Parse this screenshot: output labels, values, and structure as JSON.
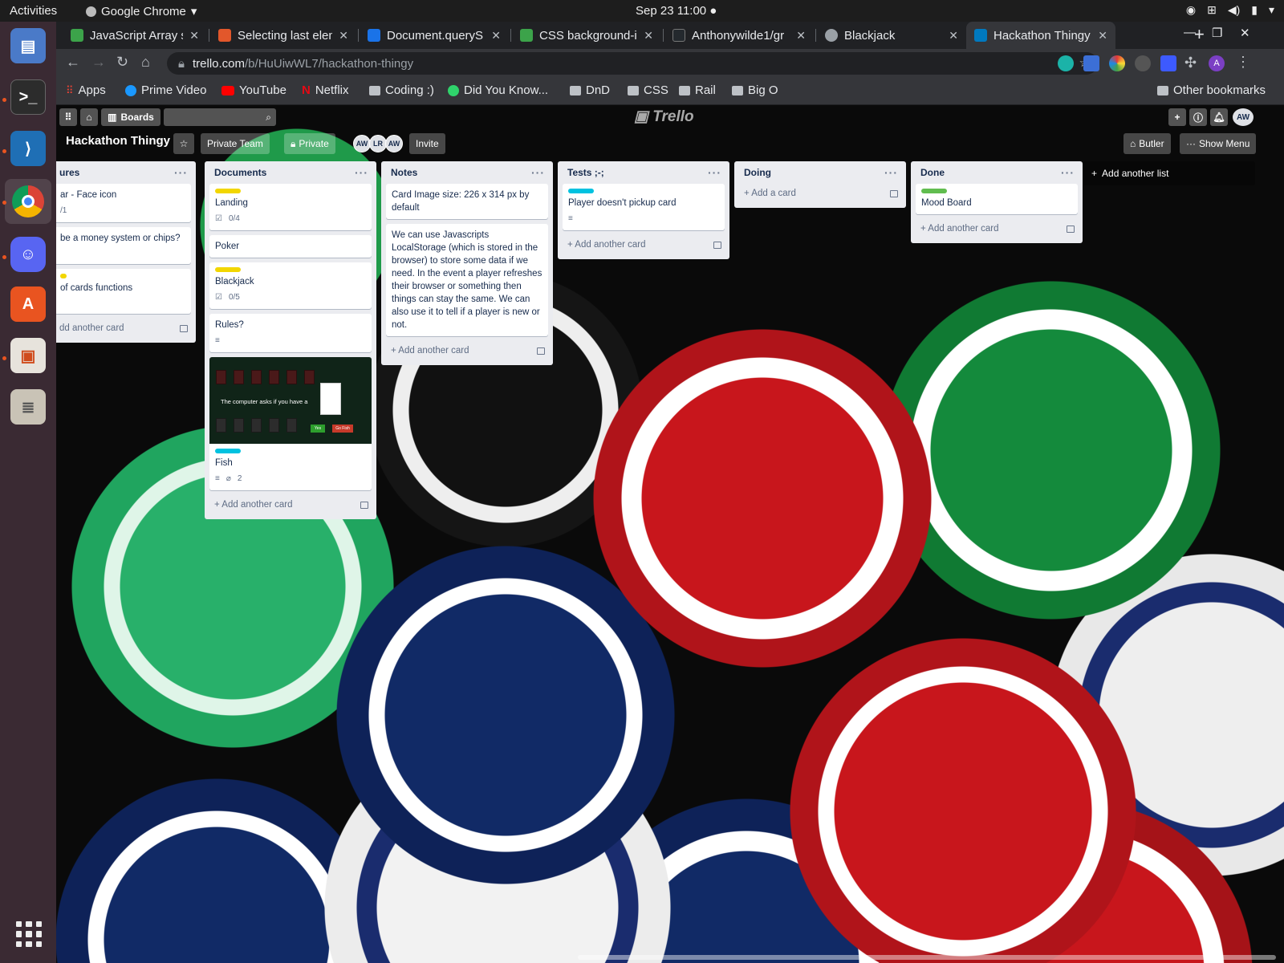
{
  "system": {
    "activities": "Activities",
    "app_name": "Google Chrome",
    "clock": "Sep 23  11:00",
    "dock": [
      "Files",
      "Terminal",
      "VS Code",
      "Chrome",
      "Discord",
      "Software",
      "Impress",
      "Archive"
    ]
  },
  "browser": {
    "tabs": [
      {
        "title": "JavaScript Array sl",
        "fav": "#3ca34a"
      },
      {
        "title": "Selecting last elem",
        "fav": "#e2572b"
      },
      {
        "title": "Document.queryS",
        "fav": "#1a73e8"
      },
      {
        "title": "CSS background-i",
        "fav": "#3ca34a"
      },
      {
        "title": "Anthonywilde1/gr",
        "fav": "#24292e"
      },
      {
        "title": "Blackjack",
        "fav": "#9aa0a6"
      },
      {
        "title": "Hackathon Thingy",
        "fav": "#0079bf"
      }
    ],
    "url_host": "trello.com",
    "url_path": "/b/HuUiwWL7/hackathon-thingy",
    "avatar_letter": "A",
    "bookmarks": [
      "Apps",
      "Prime Video",
      "YouTube",
      "Netflix",
      "Coding :)",
      "Did You Know...",
      "DnD",
      "CSS",
      "Rail",
      "Big O"
    ],
    "other_bookmarks": "Other bookmarks"
  },
  "trello": {
    "boards_label": "Boards",
    "logo": "Trello",
    "user_initials": "AW",
    "board": {
      "title": "Hackathon Thingy",
      "team": "Private Team",
      "visibility": "Private",
      "members": [
        "AW",
        "LR",
        "AW"
      ],
      "invite": "Invite",
      "butler": "Butler",
      "show_menu": "Show Menu",
      "add_list": "Add another list"
    },
    "lists": [
      {
        "name": "ures",
        "cards": [
          {
            "title": "ar - Face icon",
            "checklist": "/1"
          },
          {
            "title": "be a money system or chips?"
          },
          {
            "title": "of cards functions",
            "label": "#f2d600"
          }
        ],
        "add": "dd another card"
      },
      {
        "name": "Documents",
        "cards": [
          {
            "title": "Landing",
            "label": "#f2d600",
            "checklist": "0/4"
          },
          {
            "title": "Poker"
          },
          {
            "title": "Blackjack",
            "label": "#f2d600",
            "checklist": "0/5"
          },
          {
            "title": "Rules?",
            "desc": true
          },
          {
            "title": "Fish",
            "label": "#00c2e0",
            "desc": true,
            "attachments": "2",
            "cover_caption": "The computer asks if you have a",
            "cover_yes": "Yes",
            "cover_gofish": "Go Fish"
          }
        ],
        "add": "Add another card"
      },
      {
        "name": "Notes",
        "cards": [
          {
            "title": "Card Image size: 226 x 314 px by default"
          },
          {
            "title": "We can use Javascripts LocalStorage (which is stored in the browser) to store some data if we need. In the event a player refreshes their browser or something then things can stay the same. We can also use it to tell if a player is new or not."
          }
        ],
        "add": "Add another card"
      },
      {
        "name": "Tests ;-;",
        "cards": [
          {
            "title": "Player doesn't pickup card",
            "label": "#00c2e0",
            "desc": true
          }
        ],
        "add": "Add another card"
      },
      {
        "name": "Doing",
        "cards": [],
        "add": "Add a card"
      },
      {
        "name": "Done",
        "cards": [
          {
            "title": "Mood Board",
            "label": "#61bd4f"
          }
        ],
        "add": "Add another card"
      }
    ]
  }
}
